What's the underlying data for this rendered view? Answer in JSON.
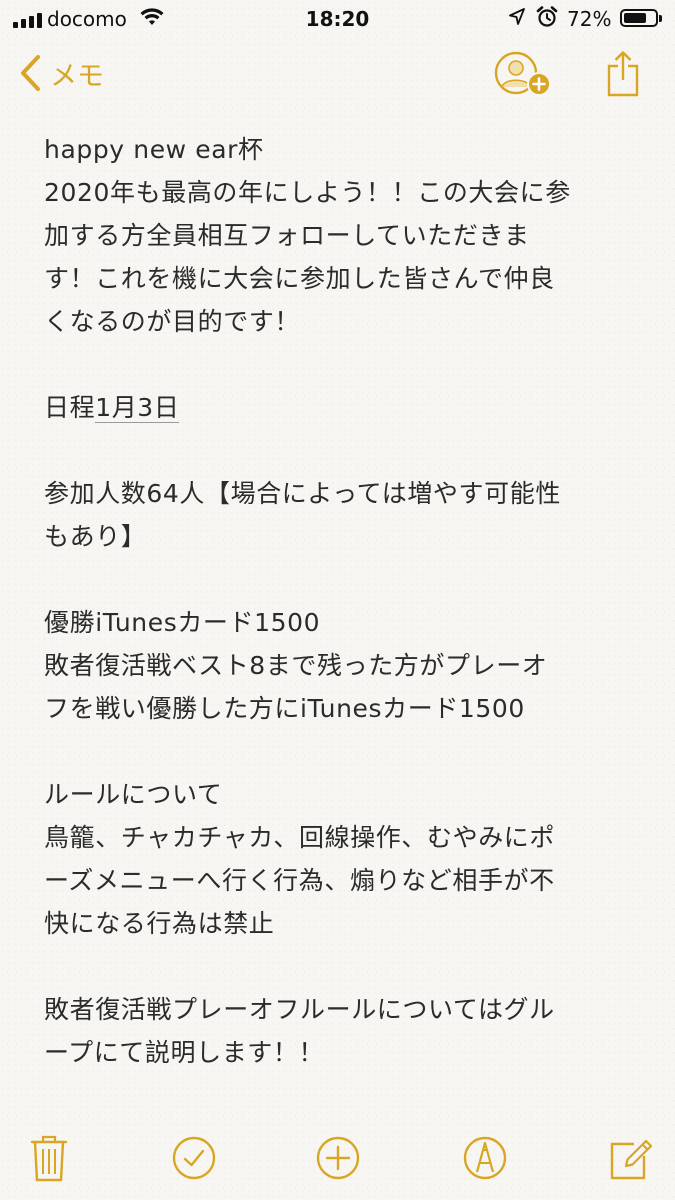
{
  "status_bar": {
    "carrier": "docomo",
    "time": "18:20",
    "battery_percent": "72%",
    "battery_level": 0.72
  },
  "nav": {
    "back_label": "メモ"
  },
  "note": {
    "title": "happy new ear杯",
    "intro_lines": [
      "2020年も最高の年にしよう！！この大会に参",
      "加する方全員相互フォローしていただきま",
      "す！これを機に大会に参加した皆さんで仲良",
      "くなるのが目的です！"
    ],
    "schedule_prefix": "日程",
    "schedule_date": "1月3日",
    "participants_lines": [
      "参加人数64人【場合によっては増やす可能性",
      "もあり】"
    ],
    "prize_lines": [
      "優勝iTunesカード1500",
      "敗者復活戦ベスト8まで残った方がプレーオ",
      "フを戦い優勝した方にiTunesカード1500"
    ],
    "rules_lines": [
      "ルールについて",
      "鳥籠、チャカチャカ、回線操作、むやみにポ",
      "ーズメニューへ行く行為、煽りなど相手が不",
      "快になる行為は禁止"
    ],
    "playoff_lines": [
      "敗者復活戦プレーオフルールについてはグル",
      "ープにて説明します！！"
    ]
  },
  "toolbar": {
    "icons": [
      "trash-icon",
      "checklist-icon",
      "add-icon",
      "sketch-icon",
      "compose-icon"
    ]
  },
  "colors": {
    "accent": "#d9a624",
    "text": "#2b2b2b",
    "background": "#f7f6f3"
  }
}
